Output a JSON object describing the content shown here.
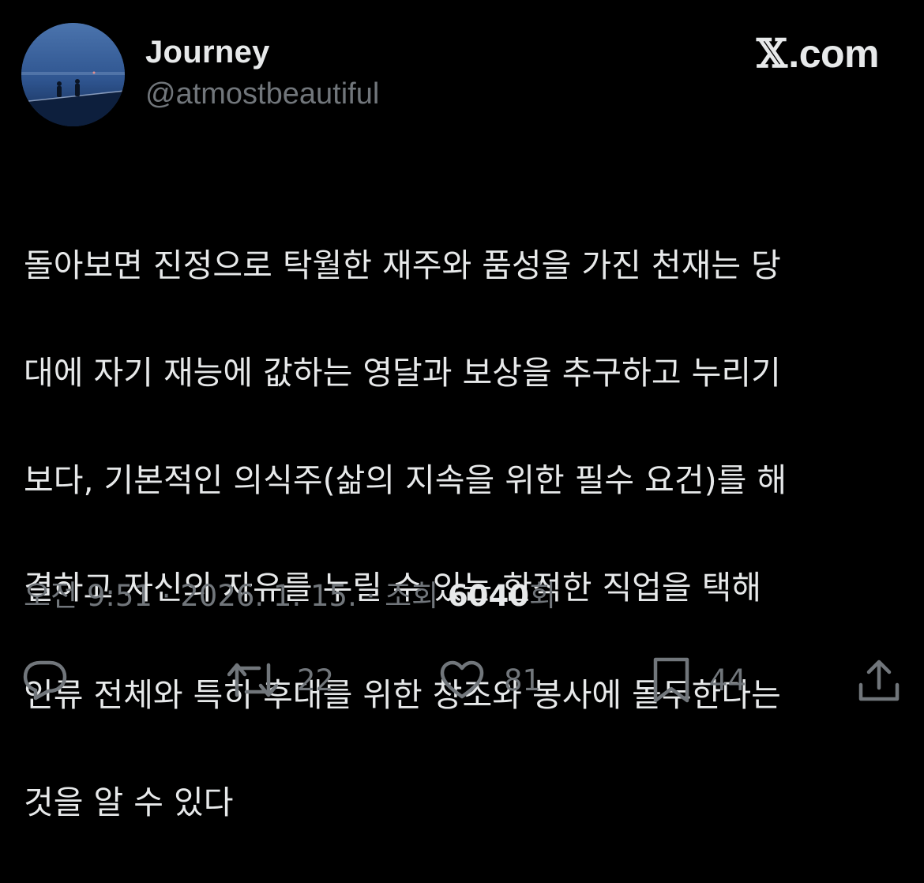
{
  "author": {
    "display_name": "Journey",
    "handle": "@atmostbeautiful"
  },
  "site": {
    "x_glyph": "𝕏",
    "domain": ".com"
  },
  "tweet": {
    "lines": [
      "돌아보면 진정으로 탁월한 재주와 품성을 가진 천재는 당",
      "대에 자기 재능에 값하는 영달과 보상을 추구하고 누리기",
      "보다, 기본적인 의식주(삶의 지속을 위한 필수 요건)를 해",
      "결하고 자신의 자유를 누릴 수 있는 한적한 직업을 택해",
      "인류 전체와 특히 후대를 위한 창조와 봉사에 몰두한다는",
      "것을 알 수 있다"
    ]
  },
  "meta": {
    "time": "오전 9:51",
    "separator1": " · ",
    "date": "2026. 1. 15.",
    "separator2": " · ",
    "views_label": "조회 ",
    "views_count": "6040",
    "views_suffix": "회"
  },
  "actions": {
    "reply": {
      "icon": "reply-icon"
    },
    "retweet": {
      "icon": "retweet-icon",
      "count": "22"
    },
    "like": {
      "icon": "heart-icon",
      "count": "81"
    },
    "bookmark": {
      "icon": "bookmark-icon",
      "count": "44"
    },
    "share": {
      "icon": "share-icon"
    }
  },
  "colors": {
    "background": "#000000",
    "primary_text": "#e7e9ea",
    "secondary_text": "#71767b"
  }
}
